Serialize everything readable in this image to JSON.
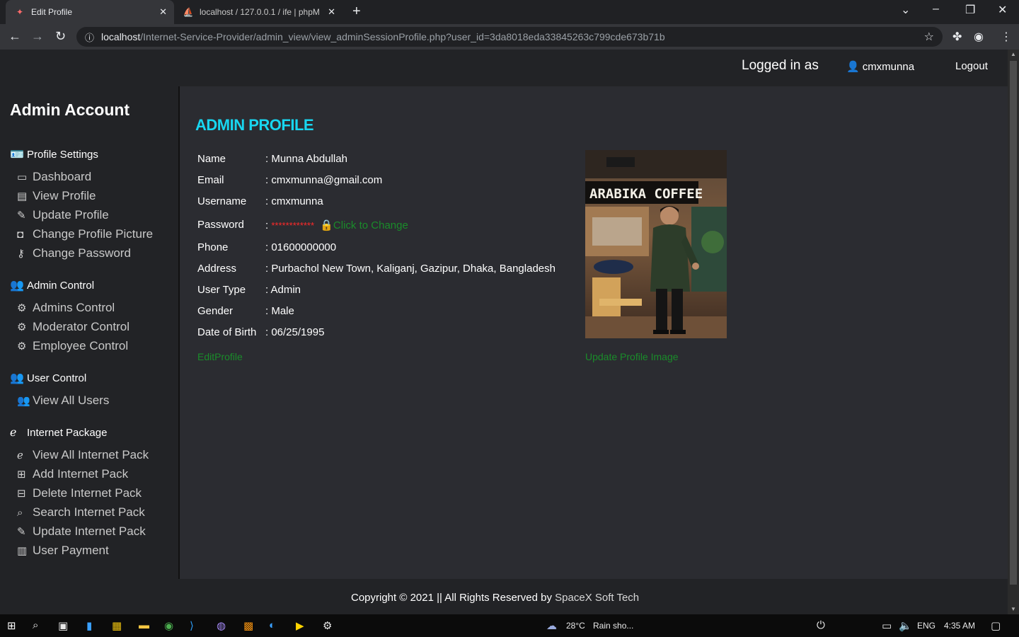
{
  "browser": {
    "tabs": [
      {
        "title": "Edit Profile",
        "active": true
      },
      {
        "title": "localhost / 127.0.0.1 / ife | phpMy",
        "active": false
      }
    ],
    "url_host": "localhost",
    "url_path": "/Internet-Service-Provider/admin_view/view_adminSessionProfile.php?user_id=3da8018eda33845263c799cde673b71b"
  },
  "topnav": {
    "logged_in_label": "Logged in as",
    "username": "cmxmunna",
    "logout": "Logout"
  },
  "sidebar": {
    "title": "Admin Account",
    "sections": [
      {
        "label": "Profile Settings",
        "icon": "id-card-icon",
        "items": [
          {
            "label": "Dashboard",
            "icon": "tablet-icon"
          },
          {
            "label": "View Profile",
            "icon": "id-card-icon"
          },
          {
            "label": "Update Profile",
            "icon": "user-edit-icon"
          },
          {
            "label": "Change Profile Picture",
            "icon": "camera-icon"
          },
          {
            "label": "Change Password",
            "icon": "key-icon"
          }
        ]
      },
      {
        "label": "Admin Control",
        "icon": "user-shield-icon",
        "items": [
          {
            "label": "Admins Control",
            "icon": "users-cog-icon"
          },
          {
            "label": "Moderator Control",
            "icon": "users-cog-icon"
          },
          {
            "label": "Employee Control",
            "icon": "users-cog-icon"
          }
        ]
      },
      {
        "label": "User Control",
        "icon": "users-cog-icon",
        "items": [
          {
            "label": "View All Users",
            "icon": "users-icon"
          }
        ]
      },
      {
        "label": "Internet Package",
        "icon": "internet-explorer-icon",
        "items": [
          {
            "label": "View All Internet Pack",
            "icon": "internet-explorer-icon"
          },
          {
            "label": "Add Internet Pack",
            "icon": "plus-square-icon"
          },
          {
            "label": "Delete Internet Pack",
            "icon": "minus-square-icon"
          },
          {
            "label": "Search Internet Pack",
            "icon": "search-icon"
          },
          {
            "label": "Update Internet Pack",
            "icon": "edit-icon"
          },
          {
            "label": "User Payment",
            "icon": "file-invoice-icon"
          }
        ]
      }
    ]
  },
  "profile": {
    "heading": "ADMIN PROFILE",
    "rows": [
      {
        "label": "Name",
        "value": ": Munna Abdullah"
      },
      {
        "label": "Email",
        "value": ": cmxmunna@gmail.com"
      },
      {
        "label": "Username",
        "value": ": cmxmunna"
      },
      {
        "label": "Password",
        "value": ":"
      },
      {
        "label": "Phone",
        "value": ": 01600000000"
      },
      {
        "label": "Address",
        "value": ": Purbachol New Town, Kaliganj, Gazipur, Dhaka, Bangladesh"
      },
      {
        "label": "User Type",
        "value": ": Admin"
      },
      {
        "label": "Gender",
        "value": ": Male"
      },
      {
        "label": "Date of Birth",
        "value": ": 06/25/1995"
      }
    ],
    "password_mask": "************",
    "password_link": "Click to Change",
    "edit_link": "EditProfile",
    "update_image_link": "Update Profile Image",
    "photo_sign": "ARABIKA COFFEE"
  },
  "footer": {
    "copyright": "Copyright © 2021 || All Rights Reserved by ",
    "brand": "SpaceX Soft Tech"
  },
  "taskbar": {
    "weather": "28°C",
    "weather_desc": "Rain sho...",
    "lang": "ENG",
    "time": "4:35 AM"
  },
  "colors": {
    "accent_heading": "#18d6f0",
    "link_green": "#1a8c2a",
    "password_red": "#ff2a2a"
  }
}
